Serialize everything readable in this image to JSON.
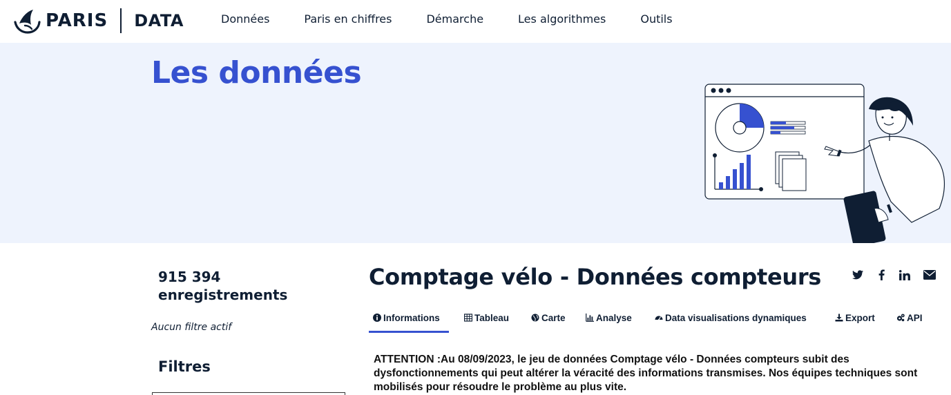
{
  "header": {
    "logo_text": "PARIS",
    "logo_suffix": "DATA",
    "nav": [
      "Données",
      "Paris en chiffres",
      "Démarche",
      "Les algorithmes",
      "Outils"
    ]
  },
  "hero": {
    "title": "Les données"
  },
  "sidebar": {
    "count_line1": "915 394",
    "count_line2": "enregistrements",
    "no_filter": "Aucun filtre actif",
    "filters_title": "Filtres"
  },
  "dataset": {
    "title": "Comptage vélo - Données compteurs",
    "share_icons": [
      "twitter-icon",
      "facebook-icon",
      "linkedin-icon",
      "email-icon"
    ],
    "tabs": [
      {
        "label": "Informations",
        "icon": "info-icon",
        "active": true
      },
      {
        "label": "Tableau",
        "icon": "table-icon",
        "active": false
      },
      {
        "label": "Carte",
        "icon": "globe-icon",
        "active": false
      },
      {
        "label": "Analyse",
        "icon": "bar-chart-icon",
        "active": false
      },
      {
        "label": "Data visualisations dynamiques",
        "icon": "dashboard-icon",
        "active": false
      },
      {
        "label": "Export",
        "icon": "download-icon",
        "active": false
      },
      {
        "label": "API",
        "icon": "cogs-icon",
        "active": false
      }
    ],
    "notice": "ATTENTION :Au 08/09/2023, le jeu de données Comptage vélo - Données compteurs subit des dysfonctionnements qui peut altérer la véracité des informations transmises. Nos équipes techniques sont mobilisés pour résoudre le problème au plus vite."
  },
  "colors": {
    "accent": "#3651d0",
    "navy": "#0f1e33",
    "hero_bg": "#eef3fd"
  }
}
